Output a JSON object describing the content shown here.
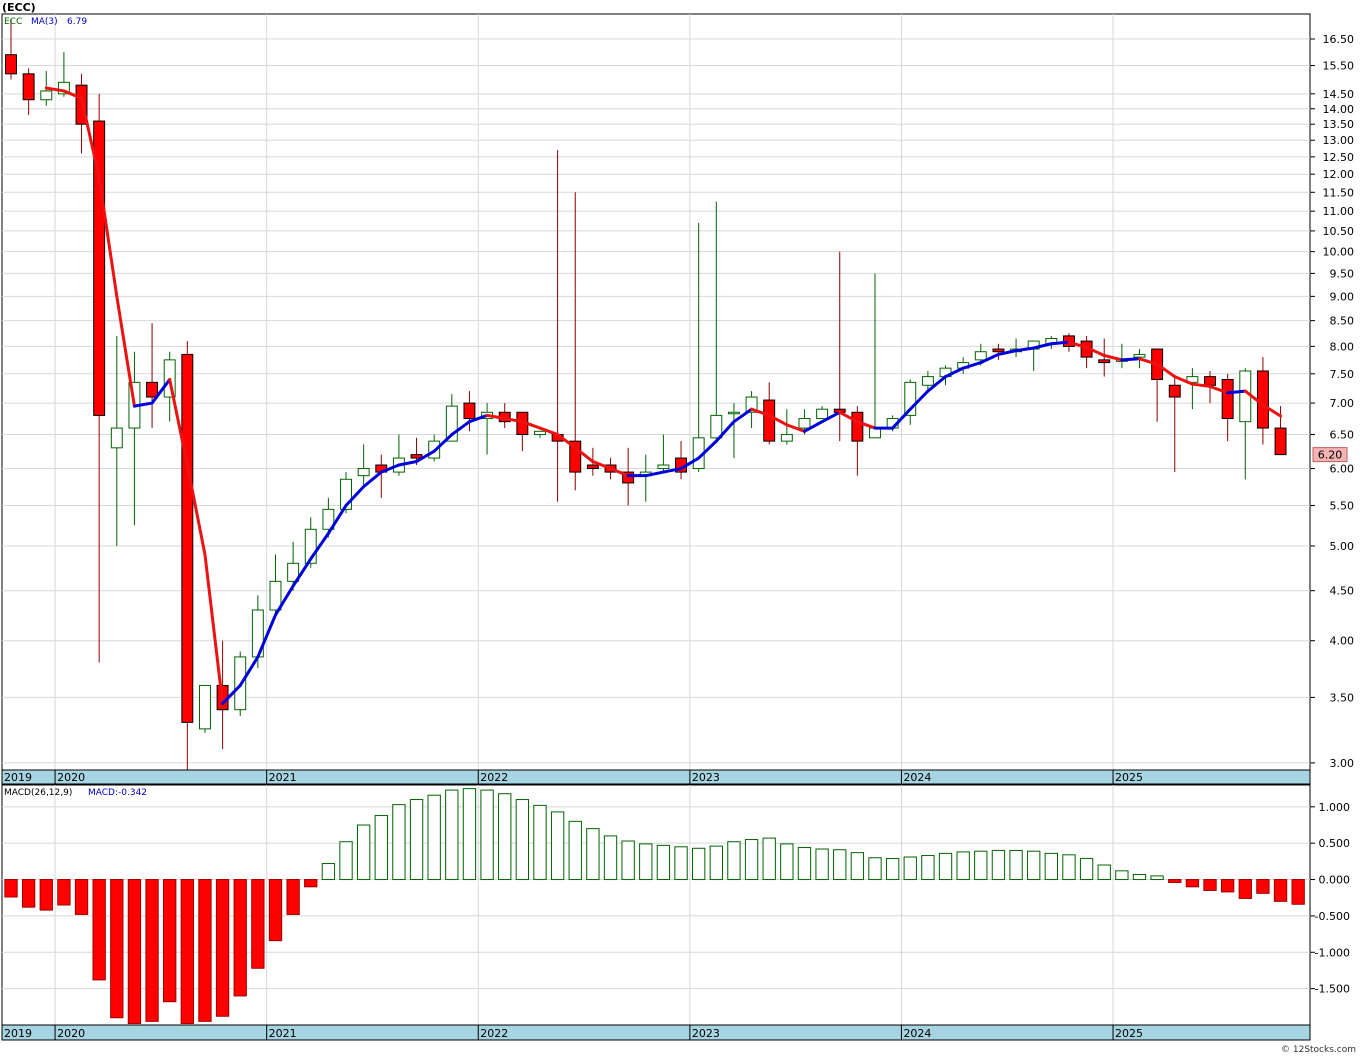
{
  "chart_data": [
    {
      "type": "candlestick",
      "title": "(ECC)",
      "ticker": "ECC",
      "indicator_label": "MA(3)",
      "indicator_value": "6.79",
      "scale": "log",
      "ylim": [
        2.95,
        17.5
      ],
      "yticks": [
        3.0,
        3.5,
        4.0,
        4.5,
        5.0,
        5.5,
        6.0,
        6.5,
        7.0,
        7.5,
        8.0,
        8.5,
        9.0,
        9.5,
        10.0,
        10.5,
        11.0,
        11.5,
        12.0,
        12.5,
        13.0,
        13.5,
        14.0,
        14.5,
        15.5,
        16.5
      ],
      "ytick_labels": [
        "3.00",
        "3.50",
        "4.00",
        "4.50",
        "5.00",
        "5.50",
        "6.00",
        "6.50",
        "7.00",
        "7.50",
        "8.00",
        "8.50",
        "9.00",
        "9.50",
        "10.00",
        "10.50",
        "11.00",
        "11.50",
        "12.00",
        "12.50",
        "13.00",
        "13.50",
        "14.00",
        "14.50",
        "15.50",
        "16.50"
      ],
      "last_price": "6.20",
      "year_labels": [
        "2019",
        "2020",
        "2021",
        "2022",
        "2023",
        "2024",
        "2025"
      ],
      "year_starts": [
        0,
        3,
        15,
        27,
        39,
        51,
        63
      ],
      "period_count": 74,
      "grid": true,
      "colors": {
        "up": "#006400",
        "down": "#ff0000",
        "ma_up": "#0000dd",
        "ma_down": "#ee1111",
        "axis_band": "#a6d4e0",
        "price_tag": "#f4b4b4"
      },
      "ohlc": [
        [
          15.9,
          17.3,
          15.0,
          15.2
        ],
        [
          15.2,
          15.4,
          13.8,
          14.3
        ],
        [
          14.3,
          15.3,
          14.1,
          14.6
        ],
        [
          14.5,
          16.0,
          14.4,
          14.9
        ],
        [
          14.8,
          15.2,
          12.6,
          13.5
        ],
        [
          13.6,
          14.5,
          3.8,
          6.8
        ],
        [
          6.3,
          8.2,
          5.0,
          6.6
        ],
        [
          6.6,
          7.9,
          5.25,
          7.35
        ],
        [
          7.35,
          8.45,
          6.6,
          7.1
        ],
        [
          7.1,
          7.9,
          6.7,
          7.75
        ],
        [
          7.85,
          8.1,
          2.95,
          3.3
        ],
        [
          3.25,
          3.6,
          3.22,
          3.6
        ],
        [
          3.6,
          4.0,
          3.1,
          3.4
        ],
        [
          3.4,
          3.9,
          3.35,
          3.85
        ],
        [
          3.85,
          4.45,
          3.75,
          4.3
        ],
        [
          4.3,
          4.9,
          4.25,
          4.6
        ],
        [
          4.6,
          5.05,
          4.5,
          4.8
        ],
        [
          4.8,
          5.35,
          4.75,
          5.2
        ],
        [
          5.2,
          5.6,
          5.1,
          5.45
        ],
        [
          5.45,
          5.95,
          5.4,
          5.85
        ],
        [
          5.9,
          6.35,
          5.75,
          6.0
        ],
        [
          6.05,
          6.2,
          5.6,
          5.95
        ],
        [
          5.95,
          6.5,
          5.9,
          6.15
        ],
        [
          6.2,
          6.45,
          6.05,
          6.15
        ],
        [
          6.15,
          6.5,
          6.1,
          6.4
        ],
        [
          6.4,
          7.15,
          6.4,
          6.95
        ],
        [
          7.0,
          7.2,
          6.55,
          6.75
        ],
        [
          6.75,
          7.0,
          6.2,
          6.85
        ],
        [
          6.85,
          7.0,
          6.6,
          6.7
        ],
        [
          6.85,
          6.85,
          6.25,
          6.5
        ],
        [
          6.5,
          6.55,
          6.45,
          6.55
        ],
        [
          6.5,
          12.7,
          5.55,
          6.4
        ],
        [
          6.4,
          11.5,
          5.7,
          5.95
        ],
        [
          6.05,
          6.3,
          5.9,
          6.0
        ],
        [
          6.05,
          6.15,
          5.85,
          5.95
        ],
        [
          5.95,
          6.3,
          5.5,
          5.8
        ],
        [
          5.9,
          6.2,
          5.55,
          5.95
        ],
        [
          6.0,
          6.5,
          5.95,
          6.05
        ],
        [
          6.15,
          6.4,
          5.85,
          5.95
        ],
        [
          6.0,
          10.7,
          5.95,
          6.45
        ],
        [
          6.45,
          11.25,
          6.4,
          6.8
        ],
        [
          6.85,
          7.0,
          6.15,
          6.85
        ],
        [
          6.85,
          7.2,
          6.6,
          7.1
        ],
        [
          7.05,
          7.35,
          6.35,
          6.4
        ],
        [
          6.4,
          6.9,
          6.35,
          6.5
        ],
        [
          6.6,
          6.9,
          6.5,
          6.75
        ],
        [
          6.75,
          6.95,
          6.75,
          6.9
        ],
        [
          6.9,
          10.0,
          6.4,
          6.85
        ],
        [
          6.85,
          6.95,
          5.9,
          6.4
        ],
        [
          6.45,
          9.5,
          6.45,
          6.6
        ],
        [
          6.6,
          6.8,
          6.55,
          6.75
        ],
        [
          6.8,
          7.4,
          6.65,
          7.35
        ],
        [
          7.3,
          7.55,
          7.2,
          7.45
        ],
        [
          7.45,
          7.65,
          7.3,
          7.6
        ],
        [
          7.6,
          7.8,
          7.5,
          7.7
        ],
        [
          7.75,
          8.05,
          7.65,
          7.9
        ],
        [
          7.95,
          8.05,
          7.75,
          7.9
        ],
        [
          7.9,
          8.15,
          7.8,
          7.95
        ],
        [
          7.95,
          8.1,
          7.55,
          8.1
        ],
        [
          8.05,
          8.2,
          7.95,
          8.15
        ],
        [
          8.2,
          8.25,
          7.9,
          8.0
        ],
        [
          8.1,
          8.2,
          7.6,
          7.8
        ],
        [
          7.75,
          8.15,
          7.45,
          7.7
        ],
        [
          7.75,
          8.05,
          7.6,
          7.75
        ],
        [
          7.8,
          7.95,
          7.6,
          7.85
        ],
        [
          7.95,
          7.95,
          6.7,
          7.4
        ],
        [
          7.3,
          7.45,
          5.95,
          7.1
        ],
        [
          7.35,
          7.6,
          6.9,
          7.45
        ],
        [
          7.45,
          7.55,
          7.0,
          7.3
        ],
        [
          7.4,
          7.5,
          6.4,
          6.75
        ],
        [
          6.7,
          7.6,
          5.85,
          7.55
        ],
        [
          7.55,
          7.8,
          6.35,
          6.6
        ],
        [
          6.6,
          6.95,
          6.2,
          6.2
        ]
      ],
      "ma3": [
        null,
        null,
        14.7,
        14.6,
        14.35,
        11.9,
        9.0,
        6.95,
        7.0,
        7.4,
        6.05,
        4.9,
        3.45,
        3.6,
        3.85,
        4.25,
        4.55,
        4.85,
        5.15,
        5.5,
        5.75,
        5.95,
        6.05,
        6.1,
        6.25,
        6.5,
        6.7,
        6.8,
        6.75,
        6.7,
        6.6,
        6.5,
        6.3,
        6.1,
        6.0,
        5.9,
        5.9,
        5.95,
        6.0,
        6.15,
        6.4,
        6.7,
        6.9,
        6.8,
        6.65,
        6.55,
        6.7,
        6.85,
        6.7,
        6.6,
        6.6,
        6.9,
        7.2,
        7.45,
        7.6,
        7.7,
        7.85,
        7.92,
        7.97,
        8.05,
        8.08,
        7.98,
        7.83,
        7.75,
        7.77,
        7.67,
        7.45,
        7.32,
        7.28,
        7.17,
        7.2,
        6.97,
        6.79
      ]
    },
    {
      "type": "bar",
      "title": "MACD(26,12,9)",
      "value_label": "MACD:-0.342",
      "ylim": [
        -2.0,
        1.3
      ],
      "yticks": [
        1.0,
        0.5,
        0.0,
        -0.5,
        -1.0,
        -1.5
      ],
      "ytick_labels": [
        "1.000",
        "0.500",
        "0.000",
        "-0.500",
        "-1.000",
        "-1.500"
      ],
      "year_labels": [
        "2019",
        "2020",
        "2021",
        "2022",
        "2023",
        "2024",
        "2025"
      ],
      "values": [
        -0.24,
        -0.38,
        -0.42,
        -0.35,
        -0.48,
        -1.38,
        -1.9,
        -1.98,
        -1.95,
        -1.68,
        -1.98,
        -1.95,
        -1.88,
        -1.6,
        -1.22,
        -0.84,
        -0.48,
        -0.1,
        0.22,
        0.52,
        0.75,
        0.88,
        1.03,
        1.1,
        1.16,
        1.23,
        1.25,
        1.23,
        1.18,
        1.1,
        1.02,
        0.93,
        0.8,
        0.7,
        0.6,
        0.53,
        0.49,
        0.47,
        0.45,
        0.43,
        0.46,
        0.52,
        0.55,
        0.57,
        0.49,
        0.44,
        0.42,
        0.41,
        0.37,
        0.3,
        0.29,
        0.31,
        0.33,
        0.36,
        0.38,
        0.39,
        0.4,
        0.4,
        0.39,
        0.36,
        0.34,
        0.29,
        0.2,
        0.12,
        0.07,
        0.05,
        -0.04,
        -0.1,
        -0.15,
        -0.17,
        -0.26,
        -0.19,
        -0.3,
        -0.34
      ]
    }
  ],
  "footer": {
    "watermark": "© 12Stocks.com"
  }
}
